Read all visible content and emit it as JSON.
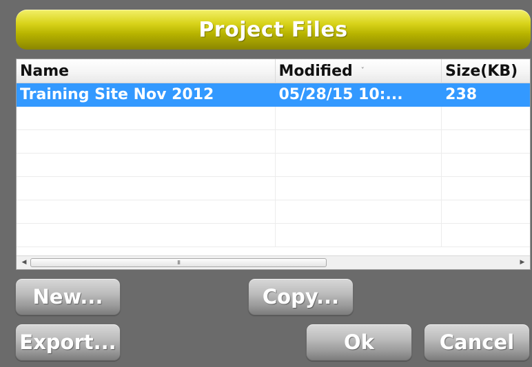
{
  "dialog": {
    "title": "Project Files"
  },
  "table": {
    "columns": [
      {
        "label": "Name"
      },
      {
        "label": "Modified",
        "sort_indicator": "˅"
      },
      {
        "label": "Size(KB)"
      }
    ],
    "rows": [
      {
        "name": "Training Site Nov 2012",
        "modified": "05/28/15 10:...",
        "size": "238",
        "selected": true
      }
    ],
    "empty_rows": 6
  },
  "scrollbar": {
    "left_arrow": "◀",
    "right_arrow": "▶",
    "grip": "III"
  },
  "buttons": {
    "new_label": "New...",
    "copy_label": "Copy...",
    "export_label": "Export...",
    "ok_label": "Ok",
    "cancel_label": "Cancel"
  },
  "colors": {
    "title_accent": "#c8c400",
    "selection": "#3399ff",
    "background": "#6b6b6b"
  }
}
